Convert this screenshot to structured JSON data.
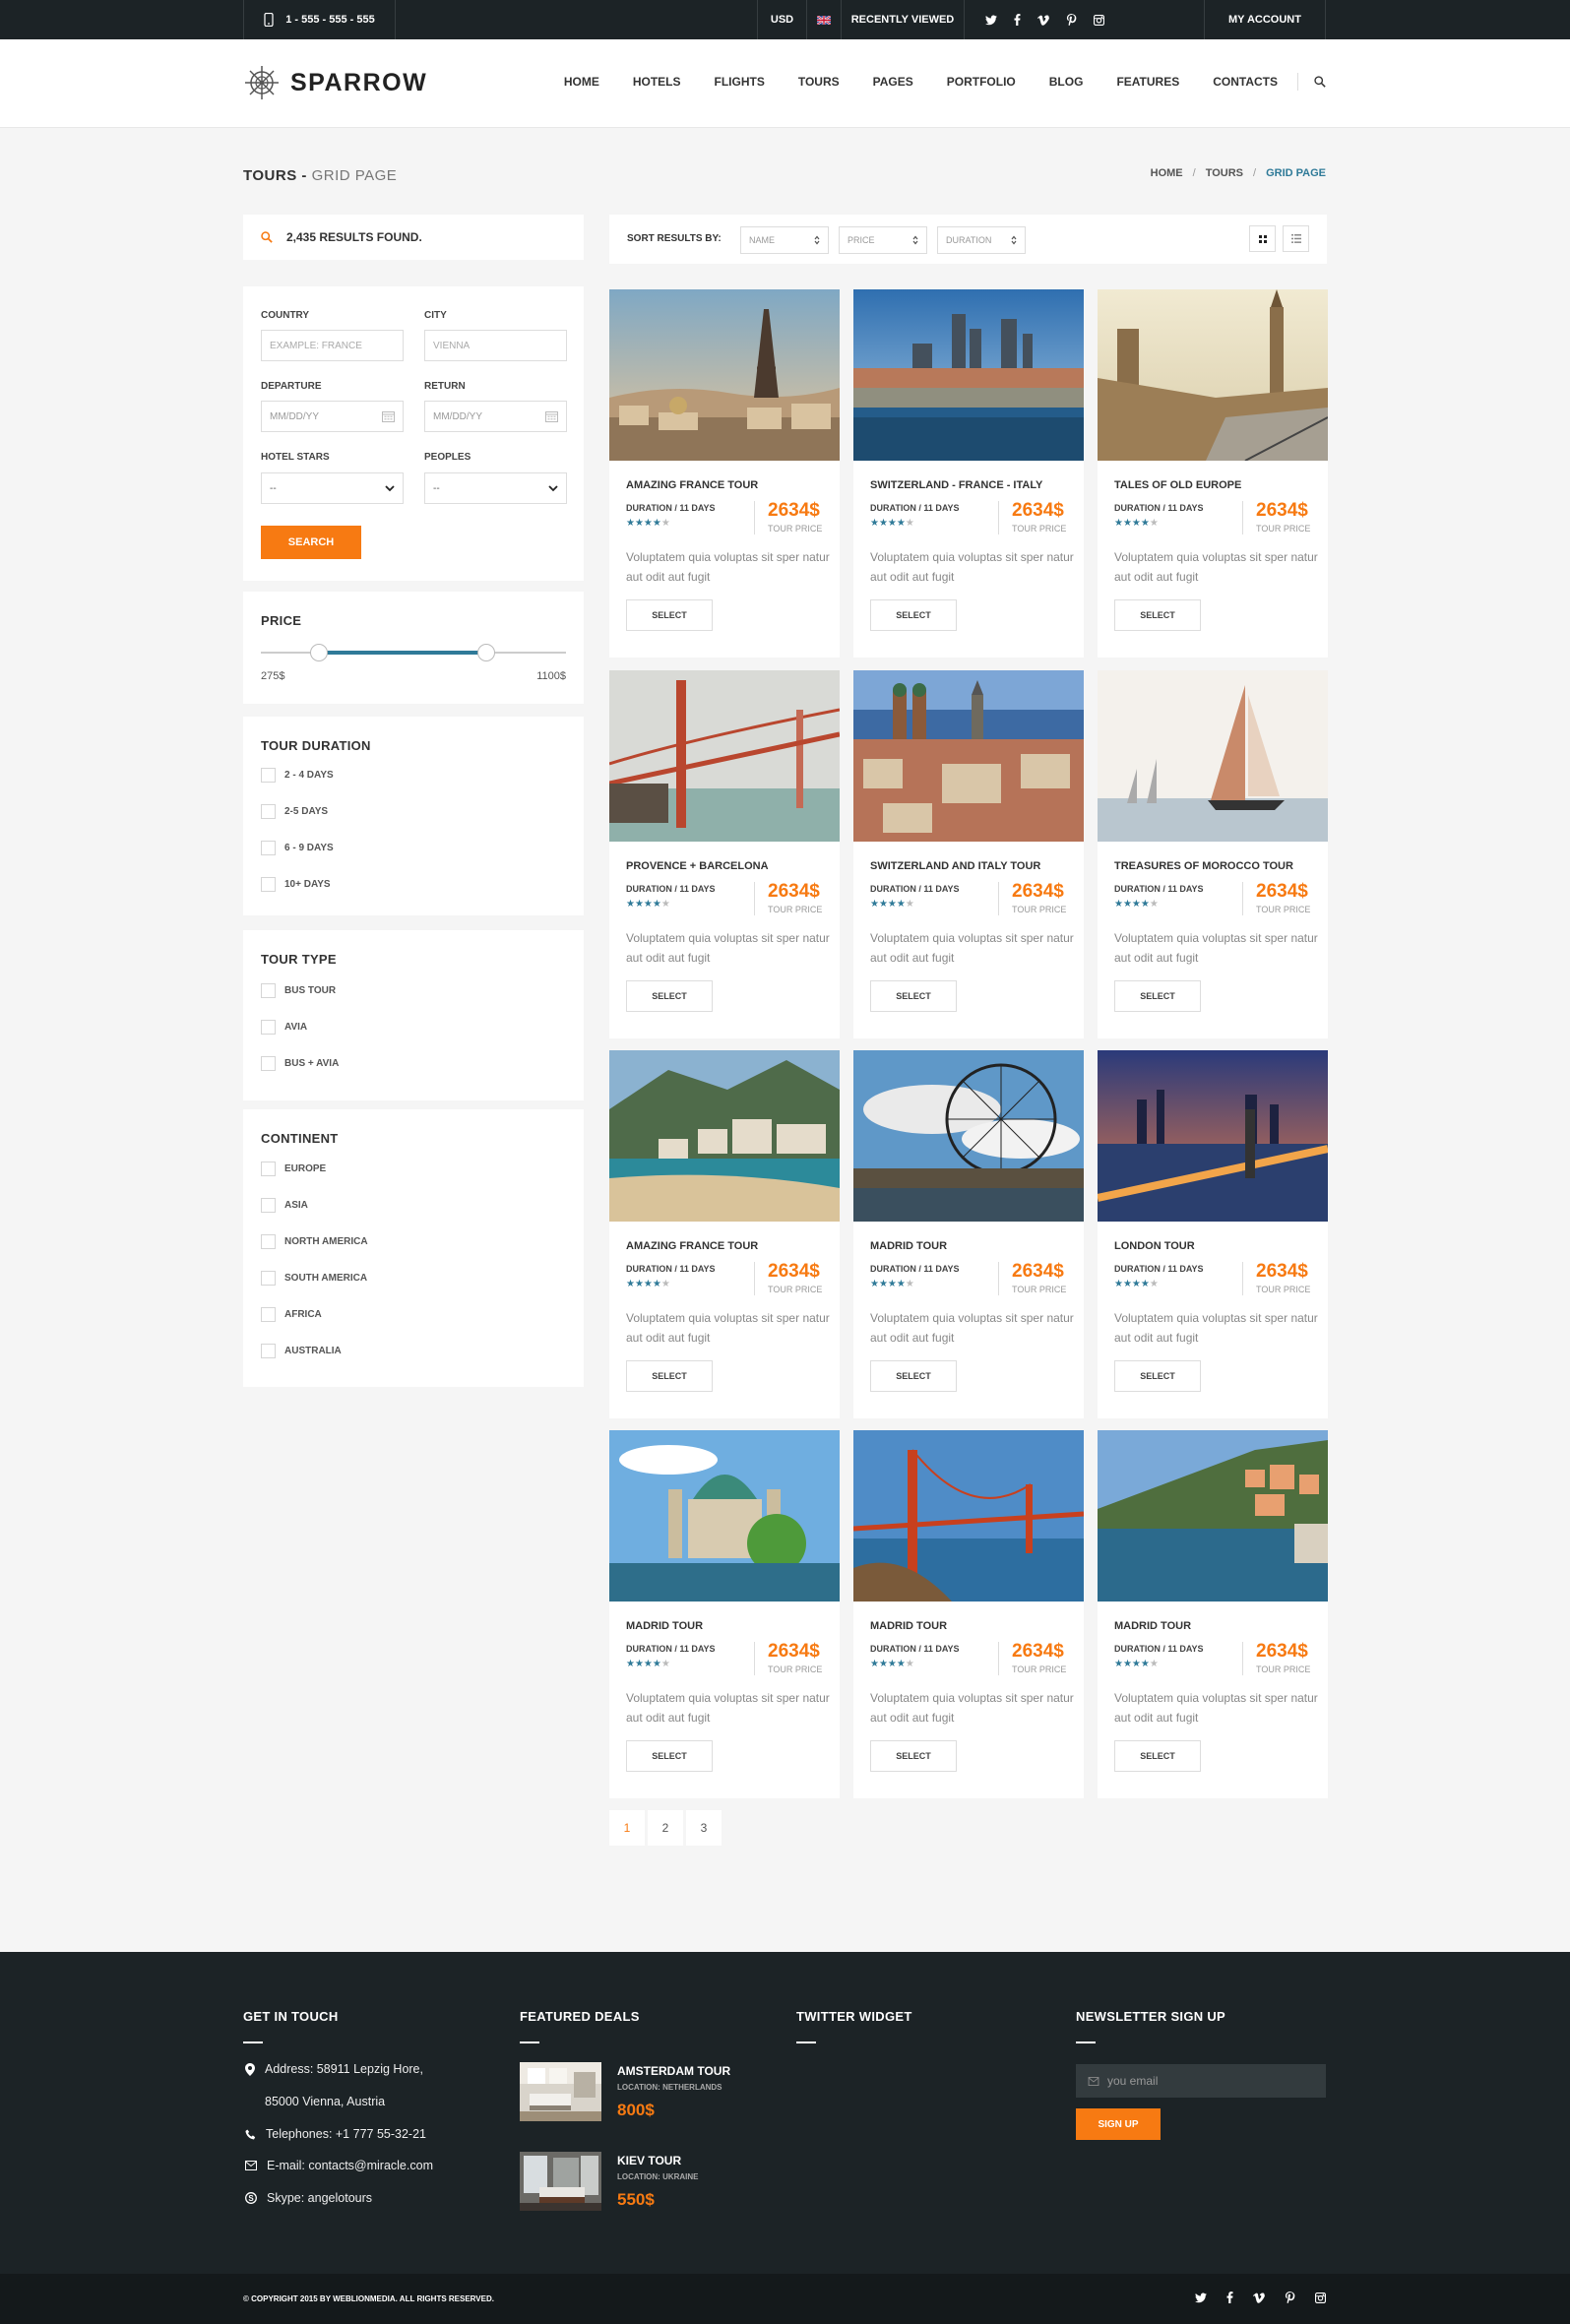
{
  "topbar": {
    "phone": "1 - 555 - 555 - 555",
    "currency": "USD",
    "recently_viewed": "RECENTLY VIEWED",
    "account": "MY ACCOUNT",
    "social": [
      "twitter-icon",
      "facebook-icon",
      "vimeo-icon",
      "pinterest-icon",
      "instagram-icon"
    ]
  },
  "header": {
    "logo": "SPARROW",
    "nav": [
      "HOME",
      "HOTELS",
      "FLIGHTS",
      "TOURS",
      "PAGES",
      "PORTFOLIO",
      "BLOG",
      "FEATURES",
      "CONTACTS"
    ]
  },
  "page": {
    "title": "TOURS -",
    "title_sub": "GRID PAGE",
    "breadcrumb": [
      "HOME",
      "TOURS",
      "GRID PAGE"
    ]
  },
  "sidebar": {
    "results": "2,435 RESULTS FOUND.",
    "country_label": "COUNTRY",
    "country_placeholder": "EXAMPLE: FRANCE",
    "city_label": "CITY",
    "city_placeholder": "VIENNA",
    "departure_label": "DEPARTURE",
    "departure_placeholder": "MM/DD/YY",
    "return_label": "RETURN",
    "return_placeholder": "MM/DD/YY",
    "stars_label": "HOTEL STARS",
    "stars_value": "--",
    "peoples_label": "PEOPLES",
    "peoples_value": "--",
    "search_button": "SEARCH",
    "price_title": "PRICE",
    "price_min": "275$",
    "price_max": "1100$",
    "price_range_fraction": [
      0.19,
      0.74
    ],
    "duration_title": "TOUR DURATION",
    "duration_options": [
      "2 - 4 DAYS",
      "2-5 DAYS",
      "6 - 9 DAYS",
      "10+ DAYS"
    ],
    "type_title": "TOUR TYPE",
    "type_options": [
      "BUS TOUR",
      "AVIA",
      "BUS + AVIA"
    ],
    "continent_title": "CONTINENT",
    "continent_options": [
      "EUROPE",
      "ASIA",
      "NORTH AMERICA",
      "SOUTH AMERICA",
      "AFRICA",
      "AUSTRALIA"
    ]
  },
  "sort": {
    "label": "SORT RESULTS BY:",
    "name": "NAME",
    "price": "PRICE",
    "duration": "DURATION"
  },
  "tours": [
    {
      "title": "AMAZING FRANCE TOUR",
      "duration": "DURATION / 11 DAYS",
      "rating": 4,
      "price": "2634$",
      "price_label": "TOUR PRICE",
      "desc": "Voluptatem quia voluptas sit sper natur aut odit aut fugit",
      "button": "SELECT"
    },
    {
      "title": "SWITZERLAND - FRANCE - ITALY",
      "duration": "DURATION / 11 DAYS",
      "rating": 4,
      "price": "2634$",
      "price_label": "TOUR PRICE",
      "desc": "Voluptatem quia voluptas sit sper natur aut odit aut fugit",
      "button": "SELECT"
    },
    {
      "title": "TALES OF OLD EUROPE",
      "duration": "DURATION / 11 DAYS",
      "rating": 4,
      "price": "2634$",
      "price_label": "TOUR PRICE",
      "desc": "Voluptatem quia voluptas sit sper natur aut odit aut fugit",
      "button": "SELECT"
    },
    {
      "title": "PROVENCE + BARCELONA",
      "duration": "DURATION / 11 DAYS",
      "rating": 4,
      "price": "2634$",
      "price_label": "TOUR PRICE",
      "desc": "Voluptatem quia voluptas sit sper natur aut odit aut fugit",
      "button": "SELECT"
    },
    {
      "title": "SWITZERLAND AND ITALY TOUR",
      "duration": "DURATION / 11 DAYS",
      "rating": 4,
      "price": "2634$",
      "price_label": "TOUR PRICE",
      "desc": "Voluptatem quia voluptas sit sper natur aut odit aut fugit",
      "button": "SELECT"
    },
    {
      "title": "TREASURES OF MOROCCO TOUR",
      "duration": "DURATION / 11 DAYS",
      "rating": 4,
      "price": "2634$",
      "price_label": "TOUR PRICE",
      "desc": "Voluptatem quia voluptas sit sper natur aut odit aut fugit",
      "button": "SELECT"
    },
    {
      "title": "AMAZING FRANCE TOUR",
      "duration": "DURATION / 11 DAYS",
      "rating": 4,
      "price": "2634$",
      "price_label": "TOUR PRICE",
      "desc": "Voluptatem quia voluptas sit sper natur aut odit aut fugit",
      "button": "SELECT"
    },
    {
      "title": "MADRID TOUR",
      "duration": "DURATION / 11 DAYS",
      "rating": 4,
      "price": "2634$",
      "price_label": "TOUR PRICE",
      "desc": "Voluptatem quia voluptas sit sper natur aut odit aut fugit",
      "button": "SELECT"
    },
    {
      "title": "LONDON TOUR",
      "duration": "DURATION / 11 DAYS",
      "rating": 4,
      "price": "2634$",
      "price_label": "TOUR PRICE",
      "desc": "Voluptatem quia voluptas sit sper natur aut odit aut fugit",
      "button": "SELECT"
    },
    {
      "title": "MADRID TOUR",
      "duration": "DURATION / 11 DAYS",
      "rating": 4,
      "price": "2634$",
      "price_label": "TOUR PRICE",
      "desc": "Voluptatem quia voluptas sit sper natur aut odit aut fugit",
      "button": "SELECT"
    },
    {
      "title": "MADRID TOUR",
      "duration": "DURATION / 11 DAYS",
      "rating": 4,
      "price": "2634$",
      "price_label": "TOUR PRICE",
      "desc": "Voluptatem quia voluptas sit sper natur aut odit aut fugit",
      "button": "SELECT"
    },
    {
      "title": "MADRID TOUR",
      "duration": "DURATION / 11 DAYS",
      "rating": 4,
      "price": "2634$",
      "price_label": "TOUR PRICE",
      "desc": "Voluptatem quia voluptas sit sper natur aut odit aut fugit",
      "button": "SELECT"
    }
  ],
  "pagination": [
    "1",
    "2",
    "3"
  ],
  "footer": {
    "contact_title": "GET IN TOUCH",
    "address1": "Address: 58911 Lepzig Hore,",
    "address2": "85000 Vienna, Austria",
    "telephone": "Telephones: +1 777 55-32-21",
    "email": "E-mail: contacts@miracle.com",
    "skype": "Skype: angelotours",
    "deals_title": "FEATURED DEALS",
    "deals": [
      {
        "title": "AMSTERDAM TOUR",
        "location": "LOCATION: NETHERLANDS",
        "price": "800$"
      },
      {
        "title": "KIEV TOUR",
        "location": "LOCATION: UKRAINE",
        "price": "550$"
      }
    ],
    "twitter_title": "TWITTER WIDGET",
    "newsletter_title": "NEWSLETTER SIGN UP",
    "newsletter_placeholder": "you email",
    "signup_button": "SIGN UP",
    "copyright": "© COPYRIGHT 2015 BY WEBLIONMEDIA. ALL RIGHTS RESERVED."
  },
  "colors": {
    "accent": "#f77a12",
    "teal": "#2f7a98",
    "dark": "#1c2326"
  }
}
